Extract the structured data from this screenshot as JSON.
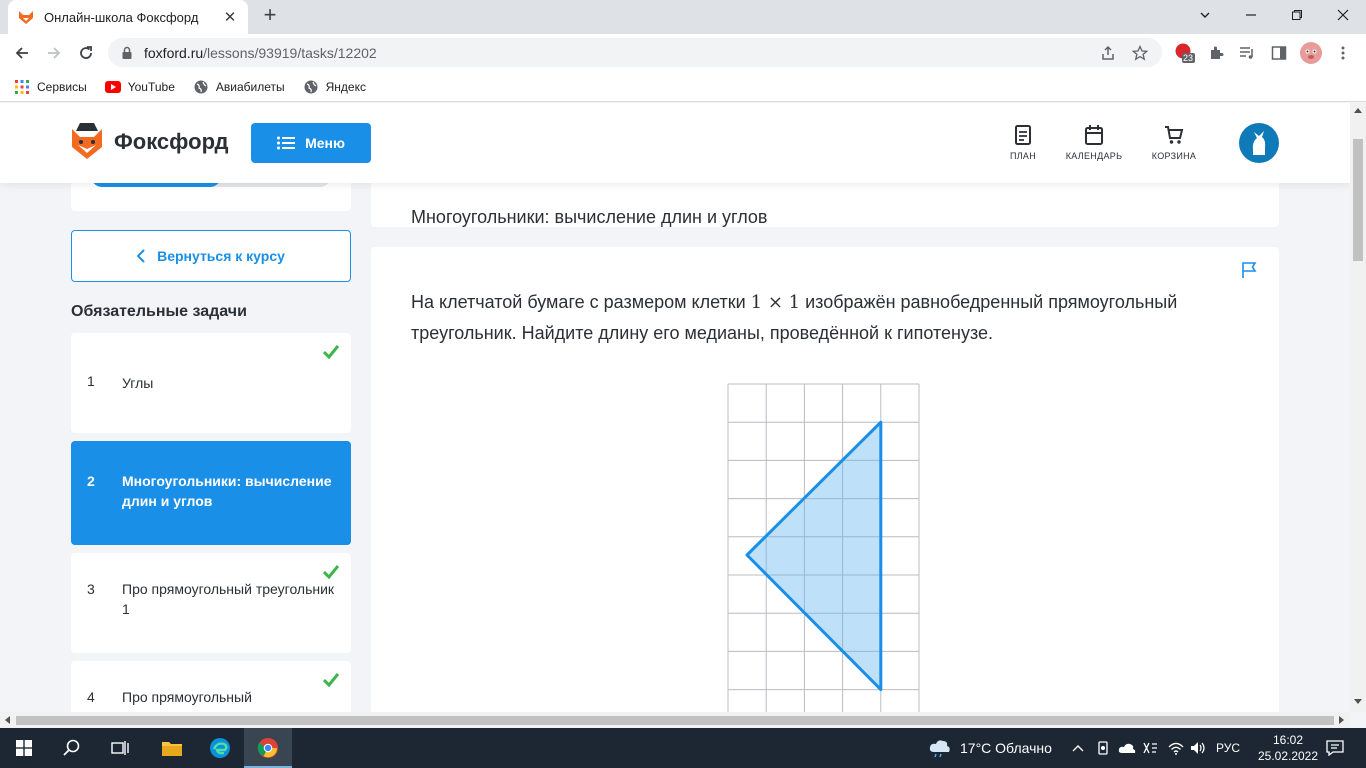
{
  "browser": {
    "tab_title": "Онлайн-школа Фоксфорд",
    "url_host": "foxford.ru",
    "url_path": "/lessons/93919/tasks/12202",
    "extension_badge": "23",
    "bookmarks": [
      {
        "label": "Сервисы"
      },
      {
        "label": "YouTube"
      },
      {
        "label": "Авиабилеты"
      },
      {
        "label": "Яндекс"
      }
    ]
  },
  "site": {
    "brand": "Фоксфорд",
    "menu_label": "Меню",
    "nav": [
      {
        "label": "ПЛАН",
        "icon": "plan-icon"
      },
      {
        "label": "КАЛЕНДАРЬ",
        "icon": "calendar-icon"
      },
      {
        "label": "КОРЗИНА",
        "icon": "cart-icon"
      }
    ],
    "accent_color": "#1a8fe8"
  },
  "sidebar": {
    "progress": 0.54,
    "back_label": "Вернуться к курсу",
    "section_title": "Обязательные задачи",
    "tasks": [
      {
        "num": "1",
        "title": "Углы",
        "done": true
      },
      {
        "num": "2",
        "title": "Многоугольники: вычисление длин и углов",
        "done": false,
        "active": true
      },
      {
        "num": "3",
        "title": "Про прямоугольный треугольник 1",
        "done": true
      },
      {
        "num": "4",
        "title": "Про прямоугольный",
        "done": true
      }
    ]
  },
  "main": {
    "lesson_title": "Многоугольники: вычисление длин и углов",
    "problem_before": "На клетчатой бумаге с размером клетки ",
    "problem_math": "1 × 1",
    "problem_after": " изображён равнобедренный прямоугольный треугольник. Найдите длину его медианы, проведённой к гипотенузе."
  },
  "taskbar": {
    "weather": "17°C Облачно",
    "language": "РУС",
    "time": "16:02",
    "date": "25.02.2022"
  }
}
